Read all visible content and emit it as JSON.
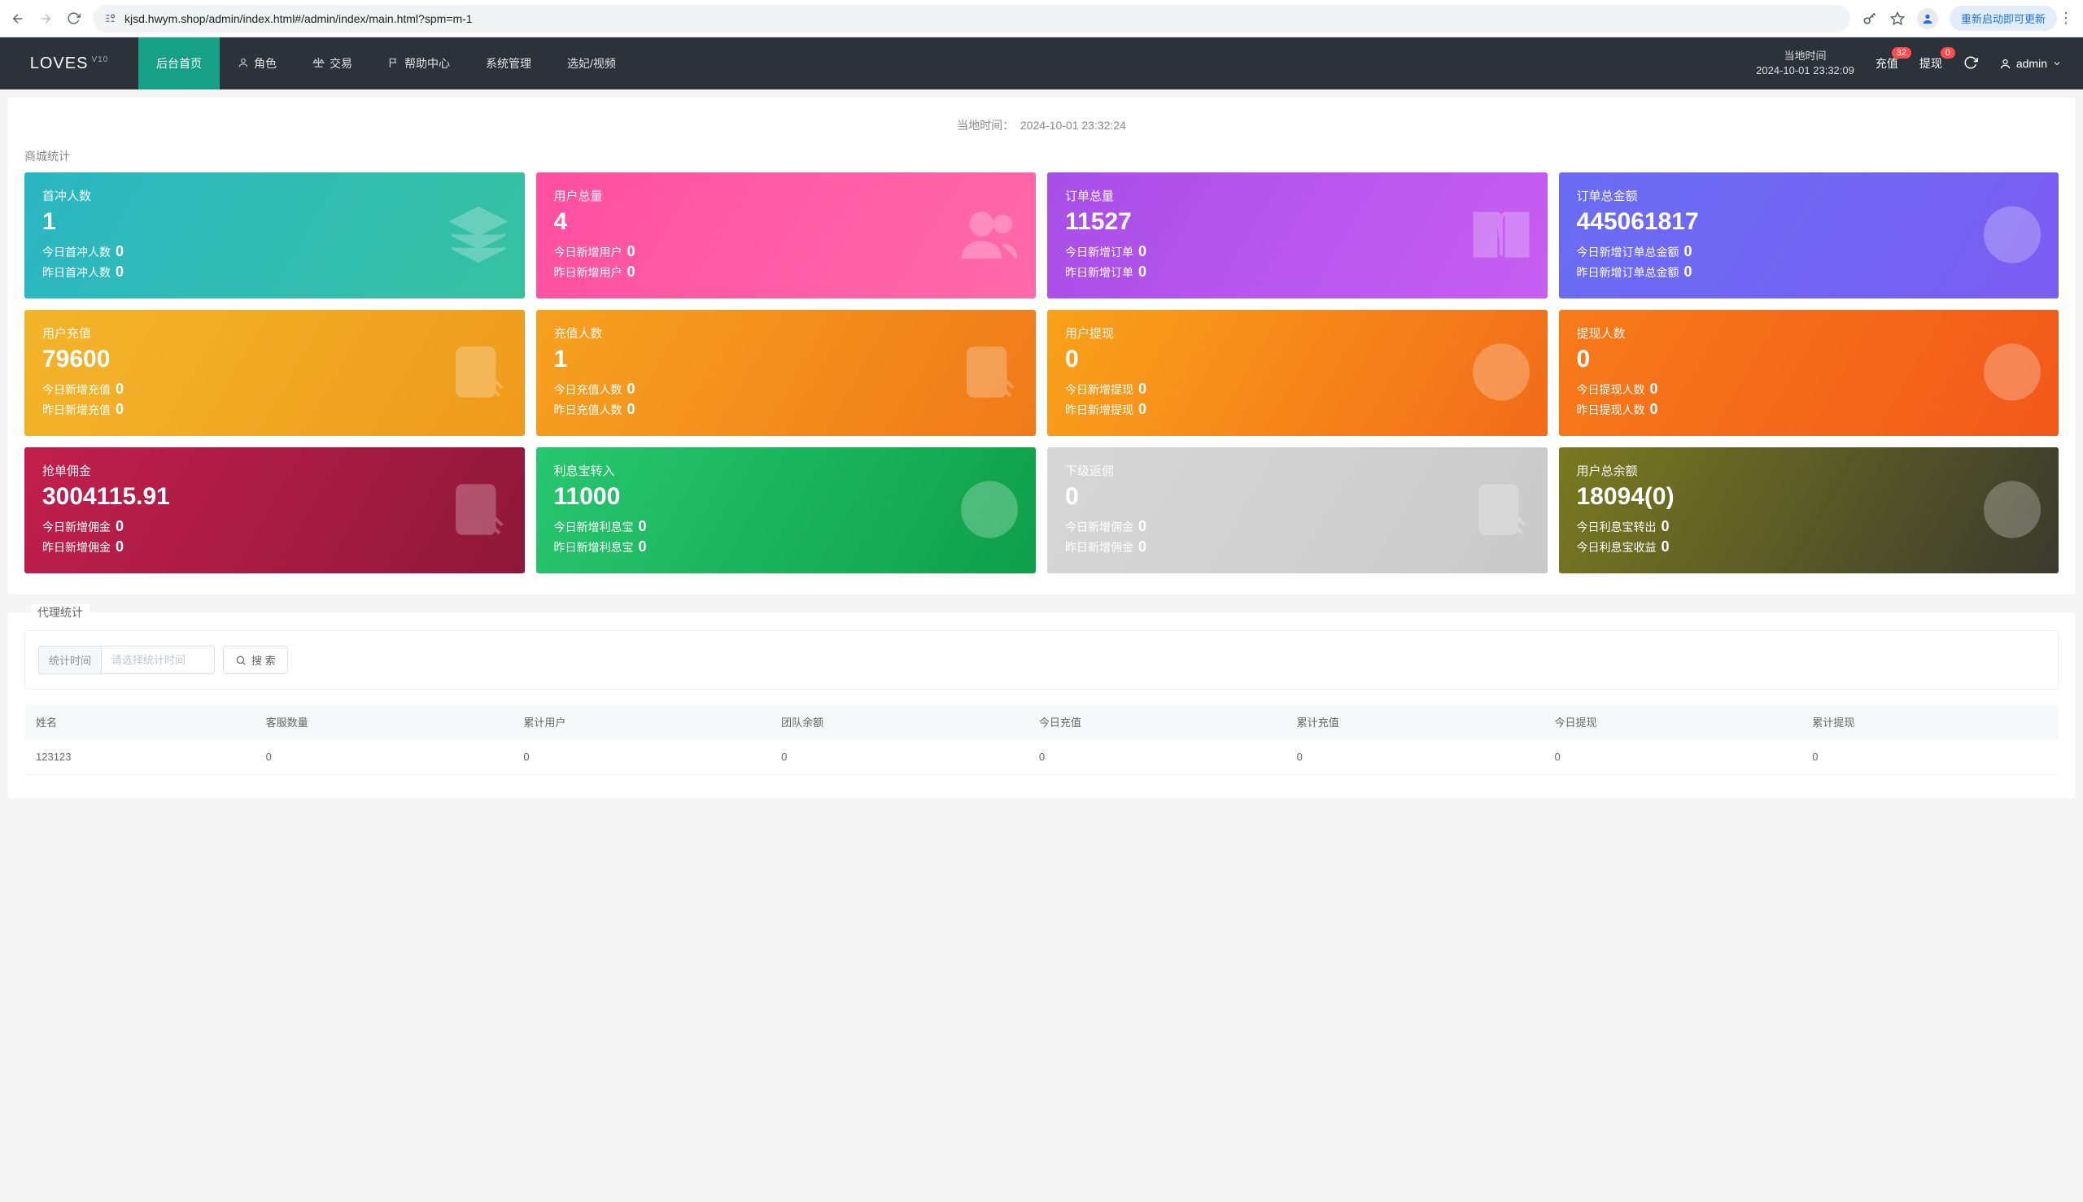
{
  "browser": {
    "url": "kjsd.hwym.shop/admin/index.html#/admin/index/main.html?spm=m-1",
    "update_label": "重新启动即可更新"
  },
  "header": {
    "logo_text": "LOVES",
    "logo_ver": "V10",
    "nav": [
      {
        "label": "后台首页",
        "icon": ""
      },
      {
        "label": "角色",
        "icon": "user"
      },
      {
        "label": "交易",
        "icon": "scale"
      },
      {
        "label": "帮助中心",
        "icon": "flag"
      },
      {
        "label": "系统管理",
        "icon": ""
      },
      {
        "label": "选妃/视频",
        "icon": ""
      }
    ],
    "local_time_label": "当地时间",
    "local_time_value": "2024-10-01 23:32:09",
    "recharge_label": "充值",
    "recharge_badge": "32",
    "withdraw_label": "提现",
    "withdraw_badge": "0",
    "user": "admin"
  },
  "page_time": {
    "label": "当地时间：",
    "value": "2024-10-01 23:32:24"
  },
  "section_title": "商城统计",
  "cards": [
    {
      "klass": "g1",
      "title": "首冲人数",
      "big": "1",
      "r1l": "今日首冲人数",
      "r1v": "0",
      "r2l": "昨日首冲人数",
      "r2v": "0",
      "icon": "layers"
    },
    {
      "klass": "g2",
      "title": "用户总量",
      "big": "4",
      "r1l": "今日新增用户",
      "r1v": "0",
      "r2l": "昨日新增用户",
      "r2v": "0",
      "icon": "users"
    },
    {
      "klass": "g3",
      "title": "订单总量",
      "big": "11527",
      "r1l": "今日新增订单",
      "r1v": "0",
      "r2l": "昨日新增订单",
      "r2v": "0",
      "icon": "book"
    },
    {
      "klass": "g4",
      "title": "订单总金额",
      "big": "445061817",
      "r1l": "今日新增订单总金额",
      "r1v": "0",
      "r2l": "昨日新增订单总金额",
      "r2v": "0",
      "icon": "yen"
    },
    {
      "klass": "g5",
      "title": "用户充值",
      "big": "79600",
      "r1l": "今日新增充值",
      "r1v": "0",
      "r2l": "昨日新增充值",
      "r2v": "0",
      "icon": "doc"
    },
    {
      "klass": "g6",
      "title": "充值人数",
      "big": "1",
      "r1l": "今日充值人数",
      "r1v": "0",
      "r2l": "昨日充值人数",
      "r2v": "0",
      "icon": "doc"
    },
    {
      "klass": "g7",
      "title": "用户提现",
      "big": "0",
      "r1l": "今日新增提现",
      "r1v": "0",
      "r2l": "昨日新增提现",
      "r2v": "0",
      "icon": "dollar"
    },
    {
      "klass": "g8",
      "title": "提现人数",
      "big": "0",
      "r1l": "今日提现人数",
      "r1v": "0",
      "r2l": "昨日提现人数",
      "r2v": "0",
      "icon": "dollar"
    },
    {
      "klass": "g9",
      "title": "抢单佣金",
      "big": "3004115.91",
      "r1l": "今日新增佣金",
      "r1v": "0",
      "r2l": "昨日新增佣金",
      "r2v": "0",
      "icon": "doc"
    },
    {
      "klass": "g10",
      "title": "利息宝转入",
      "big": "11000",
      "r1l": "今日新增利息宝",
      "r1v": "0",
      "r2l": "昨日新增利息宝",
      "r2v": "0",
      "icon": "dollar"
    },
    {
      "klass": "g11",
      "title": "下级返佣",
      "big": "0",
      "r1l": "今日新增佣金",
      "r1v": "0",
      "r2l": "昨日新增佣金",
      "r2v": "0",
      "icon": "doc"
    },
    {
      "klass": "g12",
      "title": "用户总余额",
      "big": "18094(0)",
      "r1l": "今日利息宝转出",
      "r1v": "0",
      "r2l": "今日利息宝收益",
      "r2v": "0",
      "icon": "dollar"
    }
  ],
  "agent": {
    "legend": "代理统计",
    "filter_label": "统计时间",
    "filter_placeholder": "请选择统计时间",
    "search_label": "搜 索",
    "columns": [
      "姓名",
      "客服数量",
      "累计用户",
      "团队余额",
      "今日充值",
      "累计充值",
      "今日提现",
      "累计提现"
    ],
    "rows": [
      {
        "c0": "123123",
        "c1": "0",
        "c2": "0",
        "c3": "0",
        "c4": "0",
        "c5": "0",
        "c6": "0",
        "c7": "0"
      }
    ]
  }
}
